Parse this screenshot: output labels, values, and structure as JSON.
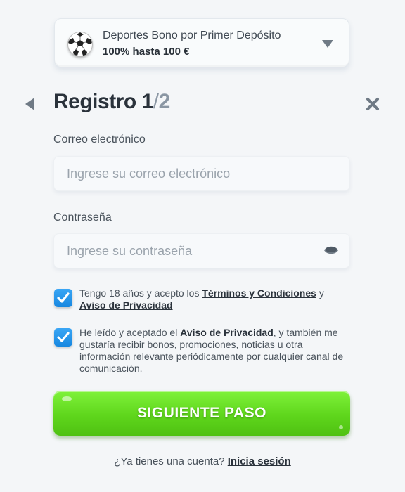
{
  "bonus": {
    "title": "Deportes Bono por Primer Depósito",
    "subtitle": "100% hasta 100 €"
  },
  "header": {
    "title": "Registro",
    "step": "1",
    "separator": "/",
    "total": "2"
  },
  "form": {
    "email_label": "Correo electrónico",
    "email_placeholder": "Ingrese su correo electrónico",
    "email_value": "",
    "password_label": "Contraseña",
    "password_placeholder": "Ingrese su contraseña",
    "password_value": ""
  },
  "consent1": {
    "checked": true,
    "text_before": "Tengo 18 años y acepto los ",
    "terms_link": "Términos y Condiciones",
    "text_middle": " y ",
    "privacy_link": "Aviso de Privacidad"
  },
  "consent2": {
    "checked": true,
    "text_before": "He leído y aceptado el ",
    "privacy_link": "Aviso de Privacidad",
    "text_after": ", y también me gustaría recibir bonos, promociones, noticias u otra información relevante periódicamente por cualquier canal de comunicación."
  },
  "cta": {
    "label": "SIGUIENTE PASO"
  },
  "login": {
    "prompt": "¿Ya tienes una cuenta? ",
    "link": "Inicia sesión"
  },
  "icons": {
    "bonus": "soccer-ball-icon",
    "dropdown": "chevron-down-icon",
    "back": "back-arrow-icon",
    "close": "close-icon",
    "toggle_password": "eye-icon",
    "checkbox": "checkmark-icon"
  },
  "colors": {
    "cta": "#5fd61c",
    "checkbox": "#1787e0",
    "background": "#f4f6f8"
  }
}
